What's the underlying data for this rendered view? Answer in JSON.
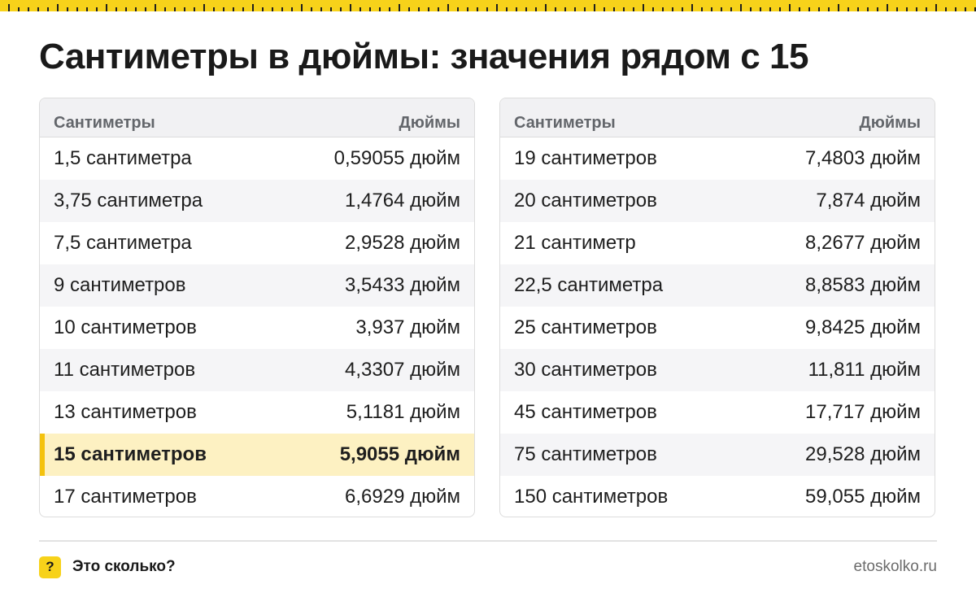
{
  "title": "Сантиметры в дюймы: значения рядом с 15",
  "colors": {
    "accent": "#f7d21a",
    "highlight_row": "#fdf1c2",
    "highlight_bar": "#f4c20d"
  },
  "tables": [
    {
      "headers": {
        "cm": "Сантиметры",
        "in": "Дюймы"
      },
      "rows": [
        {
          "cm": "1,5 сантиметра",
          "in": "0,59055 дюйм"
        },
        {
          "cm": "3,75 сантиметра",
          "in": "1,4764 дюйм"
        },
        {
          "cm": "7,5 сантиметра",
          "in": "2,9528 дюйм"
        },
        {
          "cm": "9 сантиметров",
          "in": "3,5433 дюйм"
        },
        {
          "cm": "10 сантиметров",
          "in": "3,937 дюйм"
        },
        {
          "cm": "11 сантиметров",
          "in": "4,3307 дюйм"
        },
        {
          "cm": "13 сантиметров",
          "in": "5,1181 дюйм"
        },
        {
          "cm": "15 сантиметров",
          "in": "5,9055 дюйм",
          "highlighted": true
        },
        {
          "cm": "17 сантиметров",
          "in": "6,6929 дюйм"
        }
      ]
    },
    {
      "headers": {
        "cm": "Сантиметры",
        "in": "Дюймы"
      },
      "rows": [
        {
          "cm": "19 сантиметров",
          "in": "7,4803 дюйм"
        },
        {
          "cm": "20 сантиметров",
          "in": "7,874 дюйм"
        },
        {
          "cm": "21 сантиметр",
          "in": "8,2677 дюйм"
        },
        {
          "cm": "22,5 сантиметра",
          "in": "8,8583 дюйм"
        },
        {
          "cm": "25 сантиметров",
          "in": "9,8425 дюйм"
        },
        {
          "cm": "30 сантиметров",
          "in": "11,811 дюйм"
        },
        {
          "cm": "45 сантиметров",
          "in": "17,717 дюйм"
        },
        {
          "cm": "75 сантиметров",
          "in": "29,528 дюйм"
        },
        {
          "cm": "150 сантиметров",
          "in": "59,055 дюйм"
        }
      ]
    }
  ],
  "footer": {
    "badge_icon": "question-mark-icon",
    "badge_symbol": "?",
    "brand": "Это сколько?",
    "site": "etoskolko.ru"
  }
}
